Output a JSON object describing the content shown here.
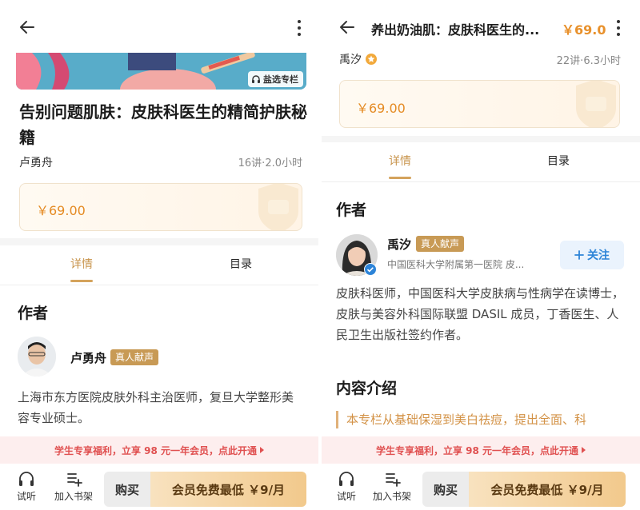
{
  "left": {
    "badge_label": "盐选专栏",
    "course_title": "告别问题肌肤：皮肤科医生的精简护肤秘籍",
    "author_name": "卢勇舟",
    "meta": "16讲·2.0小时",
    "price": "￥69.00",
    "tabs": [
      {
        "label": "详情"
      },
      {
        "label": "目录"
      }
    ],
    "section_author": "作者",
    "author_tag": "真人献声",
    "bio": "上海市东方医院皮肤外科主治医师，复旦大学整形美容专业硕士。"
  },
  "right": {
    "nav_title": "养出奶油肌：皮肤科医生的...",
    "nav_price": "￥69.0",
    "author_name": "禹汐",
    "meta": "22讲·6.3小时",
    "price": "￥69.00",
    "tabs": [
      {
        "label": "详情"
      },
      {
        "label": "目录"
      }
    ],
    "section_author": "作者",
    "author_tag": "真人献声",
    "affiliation": "中国医科大学附属第一医院 皮...",
    "follow_label": "关注",
    "bio": "皮肤科医师，中国医科大学皮肤病与性病学在读博士，皮肤与美容外科国际联盟 DASIL 成员，丁香医生、人民卫生出版社签约作者。",
    "section_intro": "内容介绍",
    "intro_text": "本专栏从基础保湿到美白祛痘，提出全面、科"
  },
  "promo": "学生专享福利，立享 98 元一年会员，点此开通",
  "bottom_bar": {
    "listen_label": "试听",
    "bookshelf_label": "加入书架",
    "buy_label": "购买",
    "member_label": "会员免费最低 ￥9/月"
  },
  "colors": {
    "accent_gold": "#c8944c",
    "price_orange": "#e58b24",
    "promo_red": "#e05151",
    "follow_blue": "#2d84d8"
  },
  "icons": [
    "back-icon",
    "more-icon",
    "headphone-icon",
    "bookshelf-add-icon",
    "plus-icon",
    "verified-icon",
    "vip-star-icon"
  ]
}
